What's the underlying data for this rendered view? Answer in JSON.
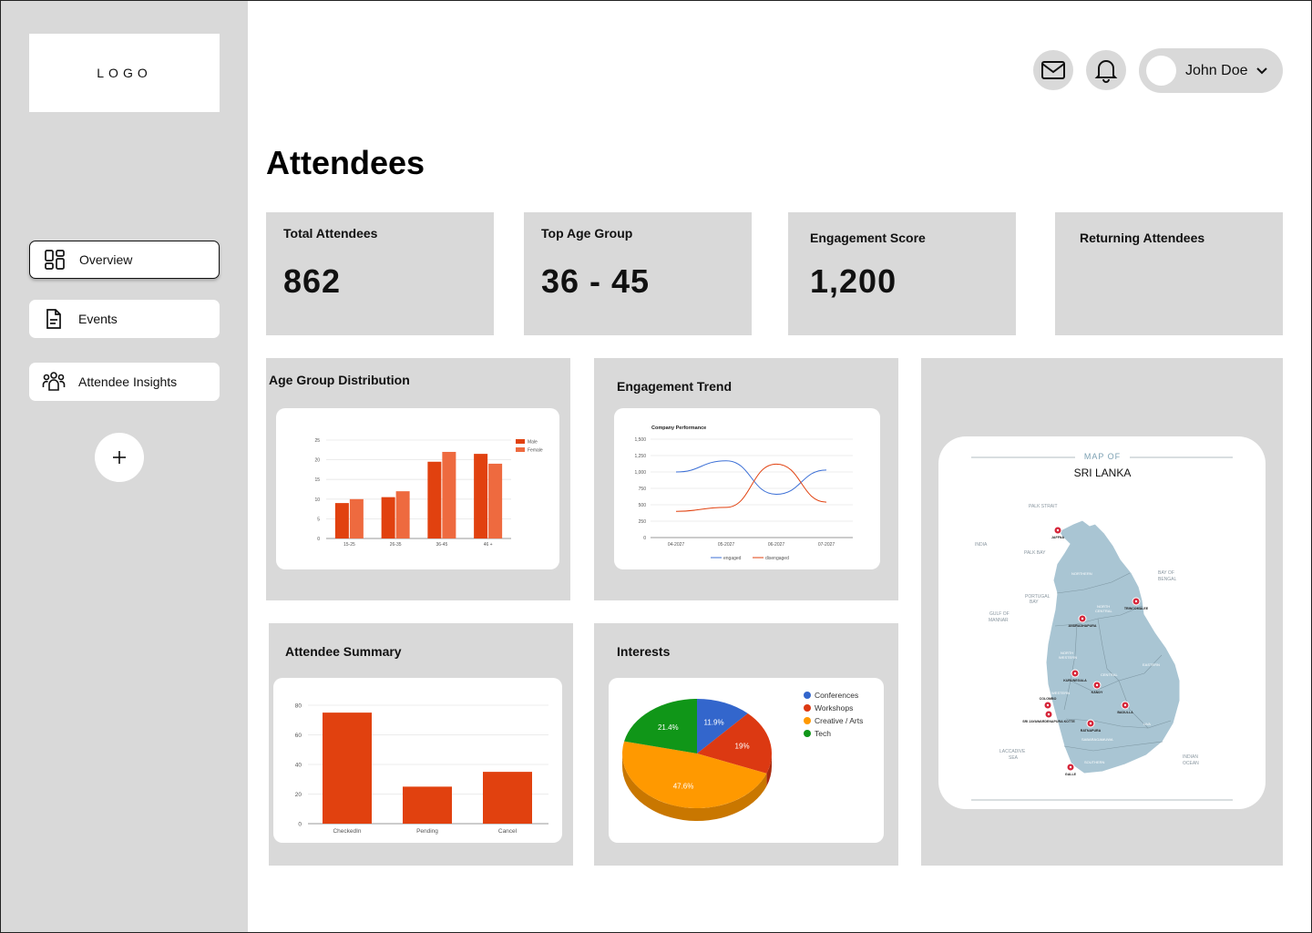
{
  "sidebar": {
    "logo": "LOGO",
    "items": [
      {
        "label": "Overview",
        "icon": "dashboard-icon"
      },
      {
        "label": "Events",
        "icon": "document-icon"
      },
      {
        "label": "Attendee Insights",
        "icon": "people-icon"
      }
    ],
    "add_label": "+"
  },
  "header": {
    "user_name": "John Doe"
  },
  "page": {
    "title": "Attendees"
  },
  "stats": [
    {
      "label": "Total Attendees",
      "value": "862"
    },
    {
      "label": "Top Age Group",
      "value": "36 - 45"
    },
    {
      "label": "Engagement Score",
      "value": "1,200"
    },
    {
      "label": "Returning Attendees",
      "value": ""
    }
  ],
  "panels": {
    "age": "Age Group Distribution",
    "engagement": "Engagement Trend",
    "summary": "Attendee Summary",
    "interests": "Interests"
  },
  "map": {
    "heading": "MAP OF",
    "title": "SRI LANKA",
    "labels": {
      "palk_strait": "PALK STRAIT",
      "india": "INDIA",
      "palk_bay": "PALK BAY",
      "bay_of_bengal_1": "BAY OF",
      "bay_of_bengal_2": "BENGAL",
      "gulf_1": "GULF OF",
      "gulf_2": "MANNAR",
      "portugal_1": "PORTUGAL",
      "portugal_2": "BAY",
      "laccadive_1": "LACCADIVE",
      "laccadive_2": "SEA",
      "indian_ocean_1": "INDIAN",
      "indian_ocean_2": "OCEAN",
      "northern": "NORTHERN",
      "north_central_1": "NORTH",
      "north_central_2": "CENTRAL",
      "north_western_1": "NORTH",
      "north_western_2": "WESTERN",
      "central": "CENTRAL",
      "eastern": "EASTERN",
      "western": "WESTERN",
      "uva": "UVA",
      "sabaragamuwa": "SABARAGAMUWA",
      "southern": "SOUTHERN"
    },
    "cities": [
      {
        "name": "JAFFNA"
      },
      {
        "name": "TRINCOMALEE"
      },
      {
        "name": "ANURADHAPURA"
      },
      {
        "name": "KURUNEGALA"
      },
      {
        "name": "KANDY"
      },
      {
        "name": "COLOMBO"
      },
      {
        "name": "SRI JAYAWARDENAPURA KOTTE"
      },
      {
        "name": "RATNAPURA"
      },
      {
        "name": "BADULLA"
      },
      {
        "name": "GALLE"
      }
    ]
  },
  "colors": {
    "bar_dark": "#e1410f",
    "bar_light": "#ee6a3f",
    "line_engaged": "#3b6fd6",
    "line_disengaged": "#e1410f",
    "pie_conferences": "#3366cc",
    "pie_workshops": "#dc3912",
    "pie_creative": "#ff9900",
    "pie_tech": "#109618",
    "map_land": "#a9c5d3",
    "city_marker": "#d6263a"
  },
  "chart_data": [
    {
      "id": "age_group",
      "type": "bar",
      "categories": [
        "15-25",
        "26-35",
        "36-45",
        "46 +"
      ],
      "series": [
        {
          "name": "Male",
          "values": [
            9,
            10.5,
            19.5,
            21.5
          ]
        },
        {
          "name": "Female",
          "values": [
            10,
            12,
            22,
            19
          ]
        }
      ],
      "yticks": [
        "0",
        "5",
        "10",
        "15",
        "20",
        "25"
      ],
      "ylim": [
        0,
        25
      ]
    },
    {
      "id": "engagement_trend",
      "type": "line",
      "title": "Company Performance",
      "x": [
        "04-2027",
        "05-2027",
        "06-2027",
        "07-2027"
      ],
      "series": [
        {
          "name": "engaged",
          "values": [
            1000,
            1170,
            660,
            1030
          ]
        },
        {
          "name": "disengaged",
          "values": [
            400,
            460,
            1120,
            540
          ]
        }
      ],
      "yticks": [
        "0",
        "250",
        "500",
        "750",
        "1,000",
        "1,250",
        "1,500"
      ],
      "ylim": [
        0,
        1500
      ]
    },
    {
      "id": "attendee_summary",
      "type": "bar",
      "categories": [
        "CheckedIn",
        "Pending",
        "Cancel"
      ],
      "values": [
        75,
        25,
        35
      ],
      "yticks": [
        "0",
        "20",
        "40",
        "60",
        "80"
      ],
      "ylim": [
        0,
        80
      ]
    },
    {
      "id": "interests",
      "type": "pie",
      "labels": [
        "Conferences",
        "Workshops",
        "Creative / Arts",
        "Tech"
      ],
      "values": [
        11.9,
        19,
        47.6,
        21.4
      ],
      "value_labels": [
        "11.9%",
        "19%",
        "47.6%",
        "21.4%"
      ]
    }
  ]
}
